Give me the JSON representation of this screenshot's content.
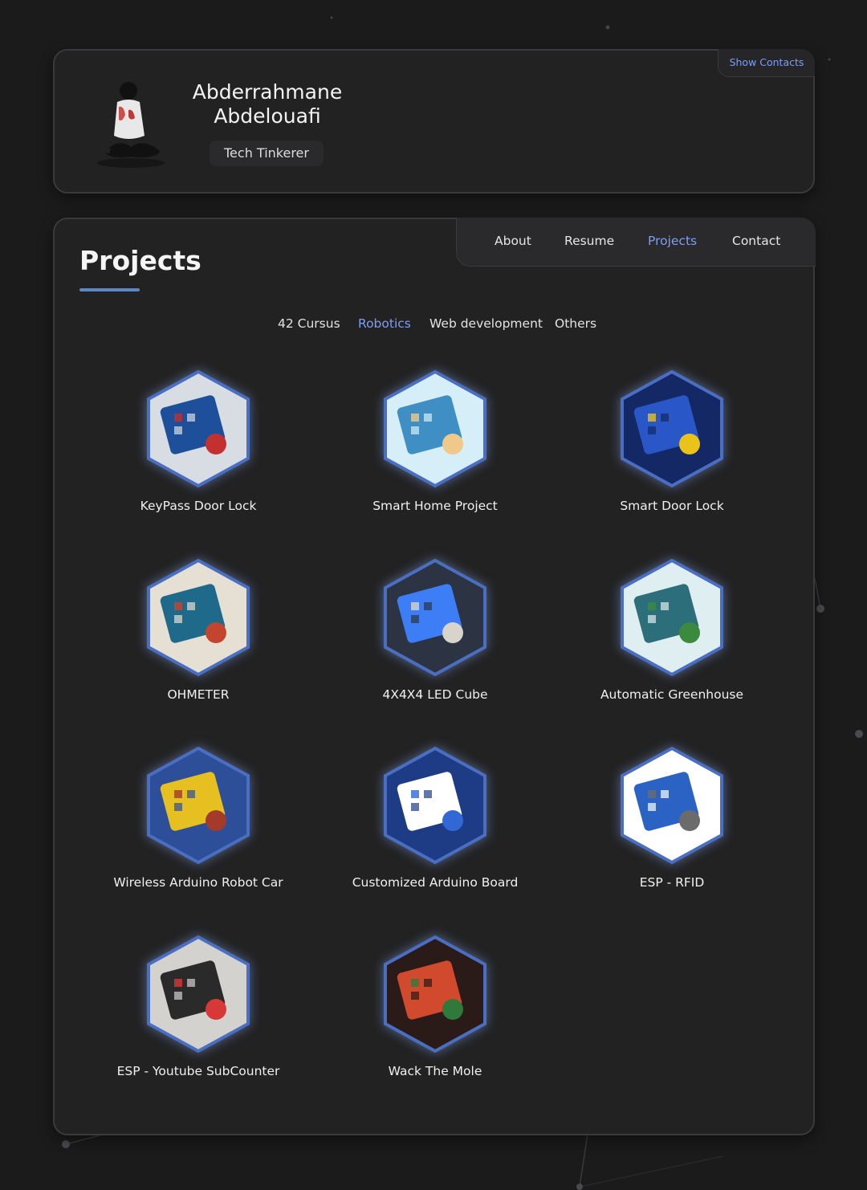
{
  "profile": {
    "name_line1": "Abderrahmane",
    "name_line2": "Abdelouafi",
    "role": "Tech Tinkerer",
    "show_contacts": "Show Contacts"
  },
  "nav": {
    "items": [
      {
        "label": "About"
      },
      {
        "label": "Resume"
      },
      {
        "label": "Projects"
      },
      {
        "label": "Contact"
      }
    ],
    "active": "Projects"
  },
  "page": {
    "title": "Projects"
  },
  "filters": {
    "items": [
      {
        "label": "42 Cursus"
      },
      {
        "label": "Robotics"
      },
      {
        "label": "Web development"
      },
      {
        "label": "Others"
      }
    ],
    "active": "Robotics"
  },
  "projects": [
    {
      "title": "KeyPass Door Lock",
      "icon": "keypad-icon"
    },
    {
      "title": "Smart Home Project",
      "icon": "smart-home-icon"
    },
    {
      "title": "Smart Door Lock",
      "icon": "door-lock-icon"
    },
    {
      "title": "OHMETER",
      "icon": "ohmmeter-icon"
    },
    {
      "title": "4X4X4 LED Cube",
      "icon": "led-cube-icon"
    },
    {
      "title": "Automatic Greenhouse",
      "icon": "greenhouse-icon"
    },
    {
      "title": "Wireless Arduino Robot Car",
      "icon": "robot-car-icon"
    },
    {
      "title": "Customized Arduino Board",
      "icon": "arduino-board-icon"
    },
    {
      "title": "ESP - RFID",
      "icon": "rfid-icon"
    },
    {
      "title": "ESP - Youtube SubCounter",
      "icon": "led-matrix-icon"
    },
    {
      "title": "Wack The Mole",
      "icon": "whack-mole-icon"
    }
  ],
  "colors": {
    "accent": "#7e9ef5",
    "title_bar": "#5a88c6",
    "card_bg": "#222223",
    "page_bg": "#1b1b1c"
  }
}
